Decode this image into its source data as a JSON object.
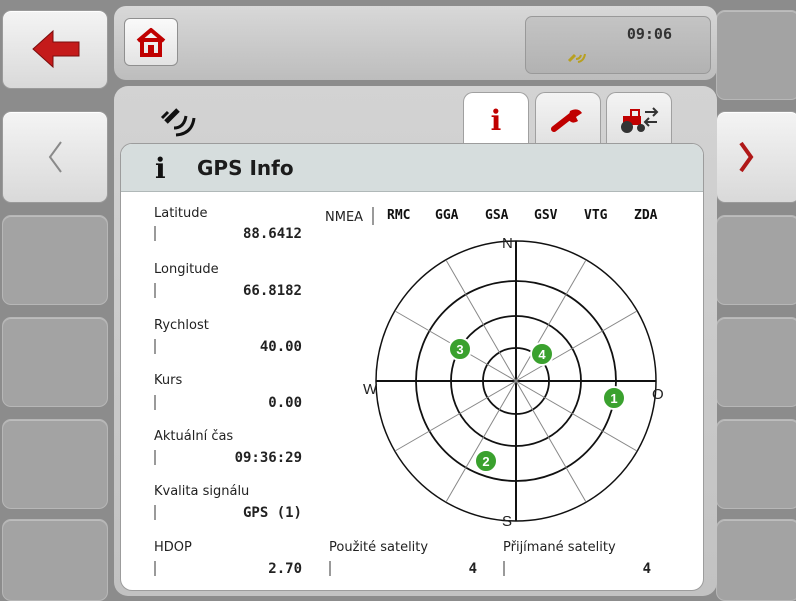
{
  "header": {
    "time": "09:06"
  },
  "card": {
    "title": "GPS Info"
  },
  "fields": [
    {
      "label": "Latitude",
      "value": "88.6412"
    },
    {
      "label": "Longitude",
      "value": "66.8182"
    },
    {
      "label": "Rychlost",
      "value": "40.00"
    },
    {
      "label": "Kurs",
      "value": "0.00"
    },
    {
      "label": "Aktuální čas",
      "value": "09:36:29"
    },
    {
      "label": "Kvalita signálu",
      "value": "GPS (1)"
    },
    {
      "label": "HDOP",
      "value": "2.70"
    }
  ],
  "nmea": {
    "label": "NMEA",
    "items": [
      "RMC",
      "GGA",
      "GSA",
      "GSV",
      "VTG",
      "ZDA"
    ]
  },
  "compass": {
    "n": "N",
    "s": "S",
    "w": "W",
    "o": "O"
  },
  "satellites_plot": [
    {
      "id": "1"
    },
    {
      "id": "2"
    },
    {
      "id": "3"
    },
    {
      "id": "4"
    }
  ],
  "used_satellites": {
    "label": "Použité satelity",
    "value": "4"
  },
  "received_satellites": {
    "label": "Přijímané satelity",
    "value": "4"
  },
  "colors": {
    "accent_red": "#c00000",
    "satellite_green": "#3aa12e"
  }
}
